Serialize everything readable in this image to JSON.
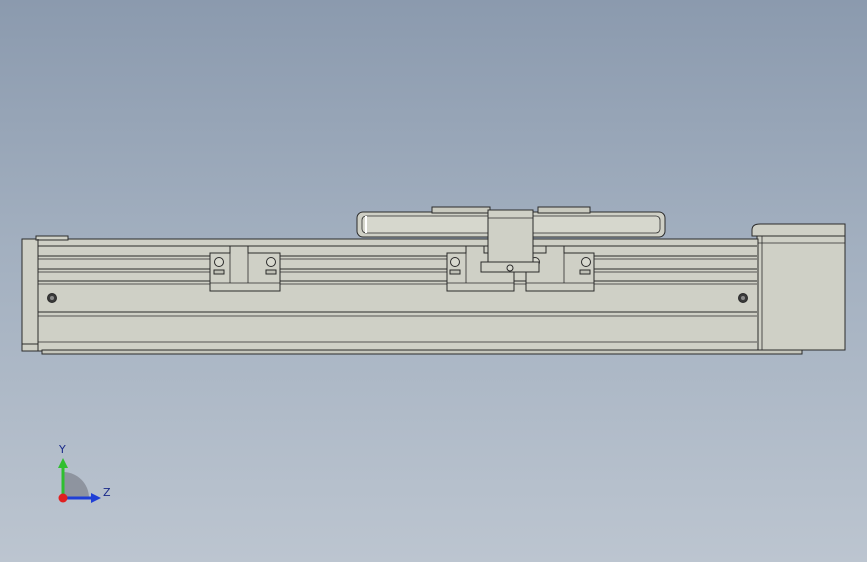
{
  "viewport": {
    "background_top": "#8b9aae",
    "background_bottom": "#bcc5d0"
  },
  "model": {
    "body_color": "#cfd0c6",
    "edge_color": "#2b2b2b",
    "shade_color": "#b9bab0"
  },
  "triad": {
    "y_label": "Y",
    "z_label": "Z",
    "y_color": "#2fbf2f",
    "z_color": "#1f3fd6",
    "x_color": "#e02020"
  }
}
